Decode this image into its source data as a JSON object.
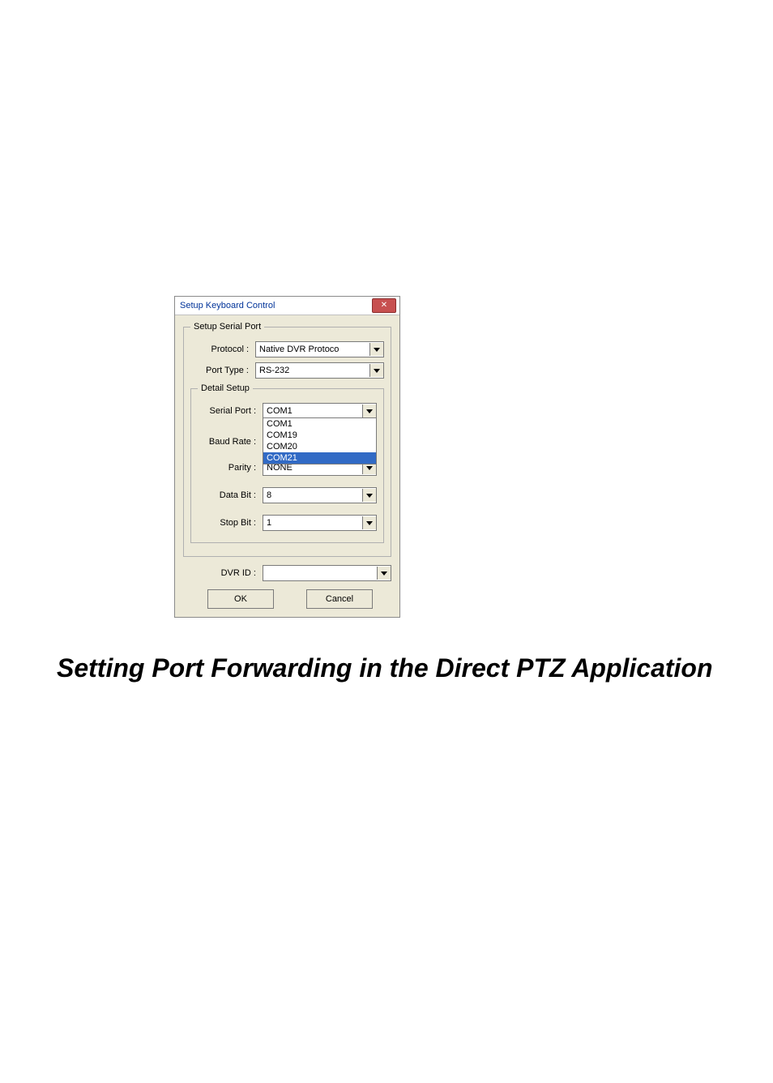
{
  "dialog": {
    "title": "Setup Keyboard Control",
    "group_setup_serial_port": "Setup Serial Port",
    "protocol_label": "Protocol :",
    "protocol_value": "Native DVR Protoco",
    "port_type_label": "Port Type :",
    "port_type_value": "RS-232",
    "group_detail_setup": "Detail Setup",
    "serial_port_label": "Serial Port :",
    "serial_port_value": "COM1",
    "serial_port_options": [
      "COM1",
      "COM19",
      "COM20",
      "COM21"
    ],
    "baud_rate_label": "Baud Rate :",
    "parity_label": "Parity :",
    "parity_value": "NONE",
    "data_bit_label": "Data Bit :",
    "data_bit_value": "8",
    "stop_bit_label": "Stop Bit :",
    "stop_bit_value": "1",
    "dvr_id_label": "DVR ID :",
    "dvr_id_value": "",
    "ok_label": "OK",
    "cancel_label": "Cancel"
  },
  "heading": "Setting Port Forwarding in the Direct PTZ Application"
}
